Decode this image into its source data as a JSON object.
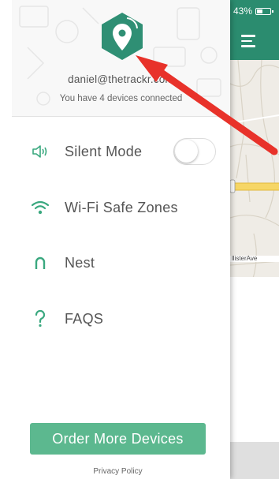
{
  "status_bar": {
    "battery": "43%"
  },
  "map": {
    "road_label": "llisterAve"
  },
  "header": {
    "email": "daniel@thetrackr.com",
    "devices_status": "You have 4 devices connected"
  },
  "menu": {
    "silent_mode": {
      "label": "Silent Mode",
      "icon": "speaker-icon",
      "enabled": false
    },
    "wifi_safe_zones": {
      "label": "Wi-Fi Safe Zones",
      "icon": "wifi-icon"
    },
    "nest": {
      "label": "Nest",
      "icon": "nest-icon"
    },
    "faqs": {
      "label": "FAQS",
      "icon": "question-icon"
    }
  },
  "footer": {
    "order_button": "Order More Devices",
    "privacy_link": "Privacy Policy"
  },
  "colors": {
    "brand": "#2b8c6f",
    "accent": "#5cb88f",
    "icon": "#3aa87f",
    "annotation_arrow": "#e8322a"
  }
}
